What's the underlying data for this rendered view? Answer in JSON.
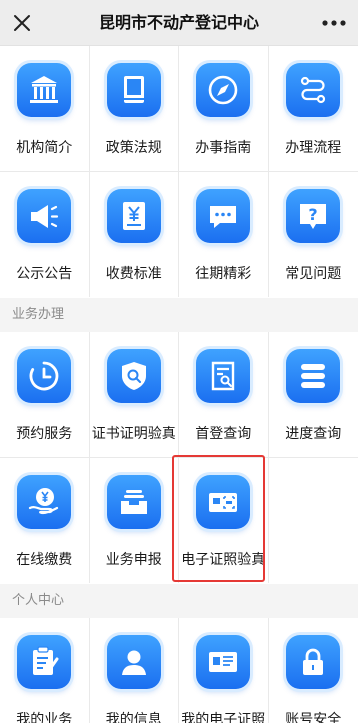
{
  "header": {
    "title": "昆明市不动产登记中心",
    "close_icon": "close-icon",
    "more_icon": "more-icon"
  },
  "grid1": {
    "items": [
      {
        "label": "机构简介",
        "icon": "institution-icon"
      },
      {
        "label": "政策法规",
        "icon": "book-icon"
      },
      {
        "label": "办事指南",
        "icon": "compass-icon"
      },
      {
        "label": "办理流程",
        "icon": "flow-icon"
      },
      {
        "label": "公示公告",
        "icon": "megaphone-icon"
      },
      {
        "label": "收费标准",
        "icon": "fee-icon"
      },
      {
        "label": "往期精彩",
        "icon": "message-icon"
      },
      {
        "label": "常见问题",
        "icon": "question-icon"
      }
    ]
  },
  "section_business": {
    "title": "业务办理",
    "items": [
      {
        "label": "预约服务",
        "icon": "clock-icon"
      },
      {
        "label": "证书证明验真",
        "icon": "shield-search-icon"
      },
      {
        "label": "首登查询",
        "icon": "document-search-icon"
      },
      {
        "label": "进度查询",
        "icon": "list-icon"
      },
      {
        "label": "在线缴费",
        "icon": "payment-icon"
      },
      {
        "label": "业务申报",
        "icon": "inbox-icon"
      },
      {
        "label": "电子证照验真",
        "icon": "card-scan-icon"
      }
    ]
  },
  "section_personal": {
    "title": "个人中心",
    "items": [
      {
        "label": "我的业务",
        "icon": "clipboard-icon"
      },
      {
        "label": "我的信息",
        "icon": "user-icon"
      },
      {
        "label": "我的电子证照",
        "icon": "id-card-icon"
      },
      {
        "label": "账号安全",
        "icon": "lock-icon"
      }
    ]
  },
  "colors": {
    "accent": "#1b6ff0",
    "highlight": "#e53935"
  }
}
